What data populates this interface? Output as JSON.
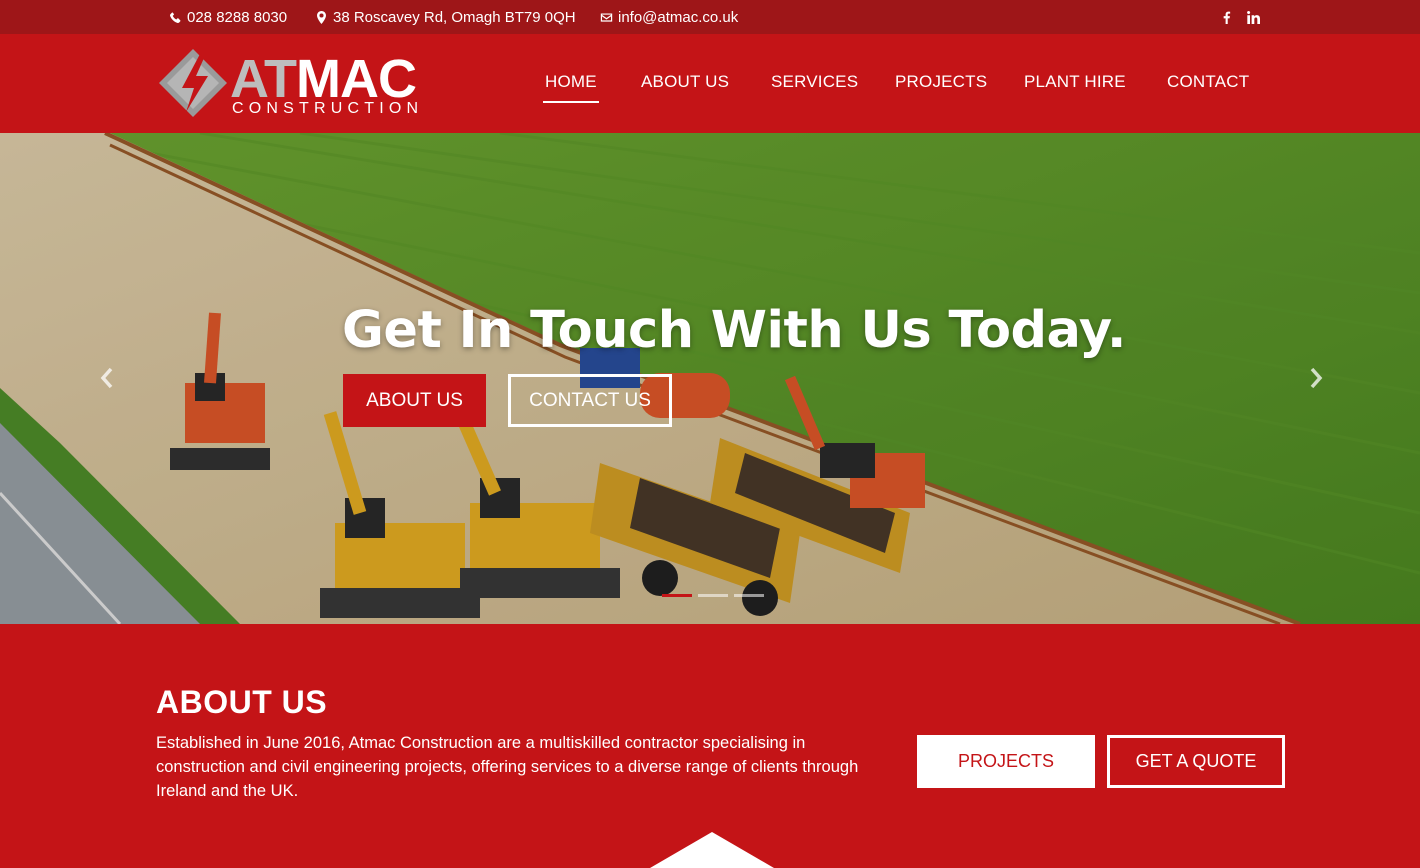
{
  "topbar": {
    "phone": "028 8288 8030",
    "address": "38 Roscavey Rd, Omagh BT79 0QH",
    "email": "info@atmac.co.uk",
    "social": [
      "facebook-icon",
      "linkedin-icon"
    ]
  },
  "logo": {
    "at": "AT",
    "mac": "MAC",
    "sub": "CONSTRUCTION"
  },
  "nav": {
    "items": [
      "HOME",
      "ABOUT US",
      "SERVICES",
      "PROJECTS",
      "PLANT HIRE",
      "CONTACT"
    ],
    "active": "HOME"
  },
  "hero": {
    "title": "Get In Touch With Us Today.",
    "primary_button": "ABOUT US",
    "secondary_button": "CONTACT US",
    "slide_count": 3,
    "active_slide": 1
  },
  "about": {
    "title": "ABOUT US",
    "text": "Established in June 2016, Atmac Construction are a multiskilled contractor specialising in construction and civil engineering projects, offering services to a diverse range of clients through Ireland and the UK.",
    "projects_button": "PROJECTS",
    "quote_button": "GET A QUOTE"
  },
  "colors": {
    "brand_red": "#c41417",
    "topbar_red": "#9e1618",
    "logo_grey": "#bdbdbd"
  }
}
